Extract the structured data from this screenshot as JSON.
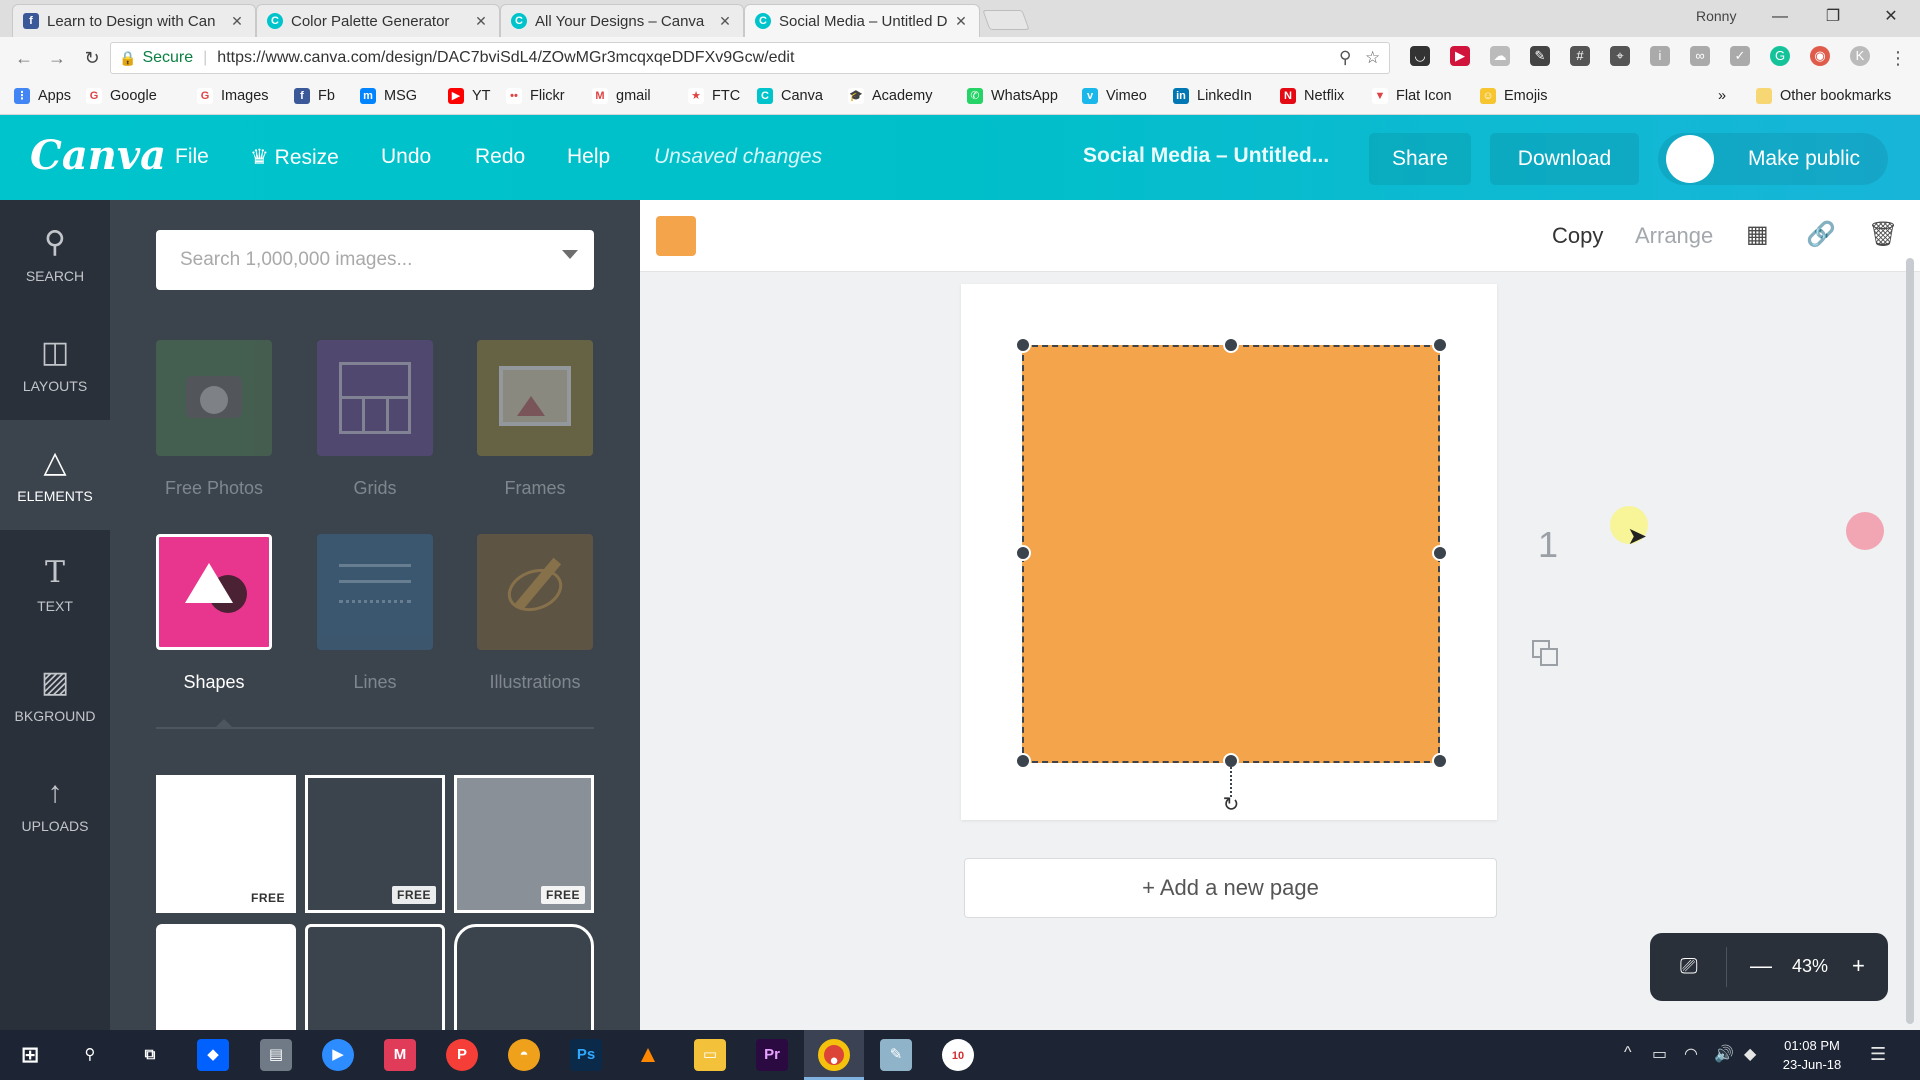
{
  "browser": {
    "tabs": [
      {
        "title": "Learn to Design with Can",
        "icon": "facebook-icon",
        "color": "#3b5998",
        "glyph": "f"
      },
      {
        "title": "Color Palette Generator",
        "icon": "canva-icon",
        "color": "#00c4cc",
        "glyph": "C"
      },
      {
        "title": "All Your Designs – Canva",
        "icon": "canva-icon",
        "color": "#00c4cc",
        "glyph": "C"
      },
      {
        "title": "Social Media – Untitled D",
        "icon": "canva-icon",
        "color": "#00c4cc",
        "glyph": "C"
      }
    ],
    "close_glyph": "✕",
    "user": "Ronny",
    "window_controls": {
      "minimize": "—",
      "maximize": "❐",
      "close": "✕"
    },
    "secure_label": "Secure",
    "url": "https://www.canva.com/design/DAC7bviSdL4/ZOwMGr3mcqxqeDDFXv9Gcw/edit",
    "bookmarks": [
      {
        "label": "Apps",
        "icon": "apps-grid-icon",
        "color": "#4285f4",
        "glyph": "⋮"
      },
      {
        "label": "Google",
        "icon": "google-icon",
        "color": "#ffffff",
        "glyph": "G"
      },
      {
        "label": "Images",
        "icon": "google-icon",
        "color": "#ffffff",
        "glyph": "G"
      },
      {
        "label": "Fb",
        "icon": "facebook-icon",
        "color": "#3b5998",
        "glyph": "f"
      },
      {
        "label": "MSG",
        "icon": "messenger-icon",
        "color": "#0084ff",
        "glyph": "m"
      },
      {
        "label": "YT",
        "icon": "youtube-icon",
        "color": "#ff0000",
        "glyph": "▶"
      },
      {
        "label": "Flickr",
        "icon": "flickr-icon",
        "color": "#ffffff",
        "glyph": "••"
      },
      {
        "label": "gmail",
        "icon": "gmail-icon",
        "color": "#ffffff",
        "glyph": "M"
      },
      {
        "label": "FTC",
        "icon": "ftc-icon",
        "color": "#ffffff",
        "glyph": "★"
      },
      {
        "label": "Canva",
        "icon": "canva-icon",
        "color": "#00c4cc",
        "glyph": "C"
      },
      {
        "label": "Academy",
        "icon": "academy-icon",
        "color": "#ffffff",
        "glyph": "🎓"
      },
      {
        "label": "WhatsApp",
        "icon": "whatsapp-icon",
        "color": "#25d366",
        "glyph": "✆"
      },
      {
        "label": "Vimeo",
        "icon": "vimeo-icon",
        "color": "#1ab7ea",
        "glyph": "v"
      },
      {
        "label": "LinkedIn",
        "icon": "linkedin-icon",
        "color": "#0077b5",
        "glyph": "in"
      },
      {
        "label": "Netflix",
        "icon": "netflix-icon",
        "color": "#e50914",
        "glyph": "N"
      },
      {
        "label": "Flat Icon",
        "icon": "flaticon-icon",
        "color": "#ffffff",
        "glyph": "▼"
      },
      {
        "label": "Emojis",
        "icon": "emoji-icon",
        "color": "#f7c52f",
        "glyph": "☺"
      }
    ],
    "overflow_glyph": "»",
    "other_bookmarks": "Other bookmarks"
  },
  "canva": {
    "logo": "Canva",
    "menu": {
      "file": "File",
      "resize": "Resize",
      "undo": "Undo",
      "redo": "Redo",
      "help": "Help",
      "unsaved": "Unsaved changes"
    },
    "title": "Social Media – Untitled...",
    "share": "Share",
    "download": "Download",
    "make_public": "Make public",
    "accent": "#00c4cc"
  },
  "rail": [
    {
      "label": "SEARCH",
      "icon": "search-icon",
      "glyph": "⚲"
    },
    {
      "label": "LAYOUTS",
      "icon": "layouts-icon",
      "glyph": "◫"
    },
    {
      "label": "ELEMENTS",
      "icon": "elements-icon",
      "glyph": "△"
    },
    {
      "label": "TEXT",
      "icon": "text-icon",
      "glyph": "T"
    },
    {
      "label": "BKGROUND",
      "icon": "background-icon",
      "glyph": "▨"
    },
    {
      "label": "UPLOADS",
      "icon": "upload-icon",
      "glyph": "↑"
    }
  ],
  "panel": {
    "search_placeholder": "Search 1,000,000 images...",
    "categories": [
      {
        "label": "Free Photos",
        "icon": "camera-icon",
        "color": "#4f7f55"
      },
      {
        "label": "Grids",
        "icon": "grid-icon",
        "color": "#6a4f9a"
      },
      {
        "label": "Frames",
        "icon": "frame-icon",
        "color": "#9c8b3c"
      },
      {
        "label": "Shapes",
        "icon": "shapes-icon",
        "color": "#e8368f"
      },
      {
        "label": "Lines",
        "icon": "lines-icon",
        "color": "#3d6f9a"
      },
      {
        "label": "Illustrations",
        "icon": "illustration-icon",
        "color": "#8a6a3a"
      }
    ],
    "free_label": "FREE",
    "tiles": [
      {
        "color": "#ffffff"
      },
      {
        "color": "#3b434c"
      },
      {
        "color": "#8a9098"
      },
      {
        "color": "#ffffff"
      },
      {
        "color": "#3b434c"
      },
      {
        "color": "#3b434c"
      }
    ]
  },
  "editor": {
    "shape_color": "#f4a44a",
    "copy": "Copy",
    "arrange": "Arrange",
    "page_number": "1",
    "add_page": "+ Add a new page",
    "zoom": "43%",
    "zoom_minus": "—",
    "zoom_plus": "+"
  },
  "taskbar": {
    "time": "01:08 PM",
    "date": "23-Jun-18",
    "notification_count": "10"
  }
}
